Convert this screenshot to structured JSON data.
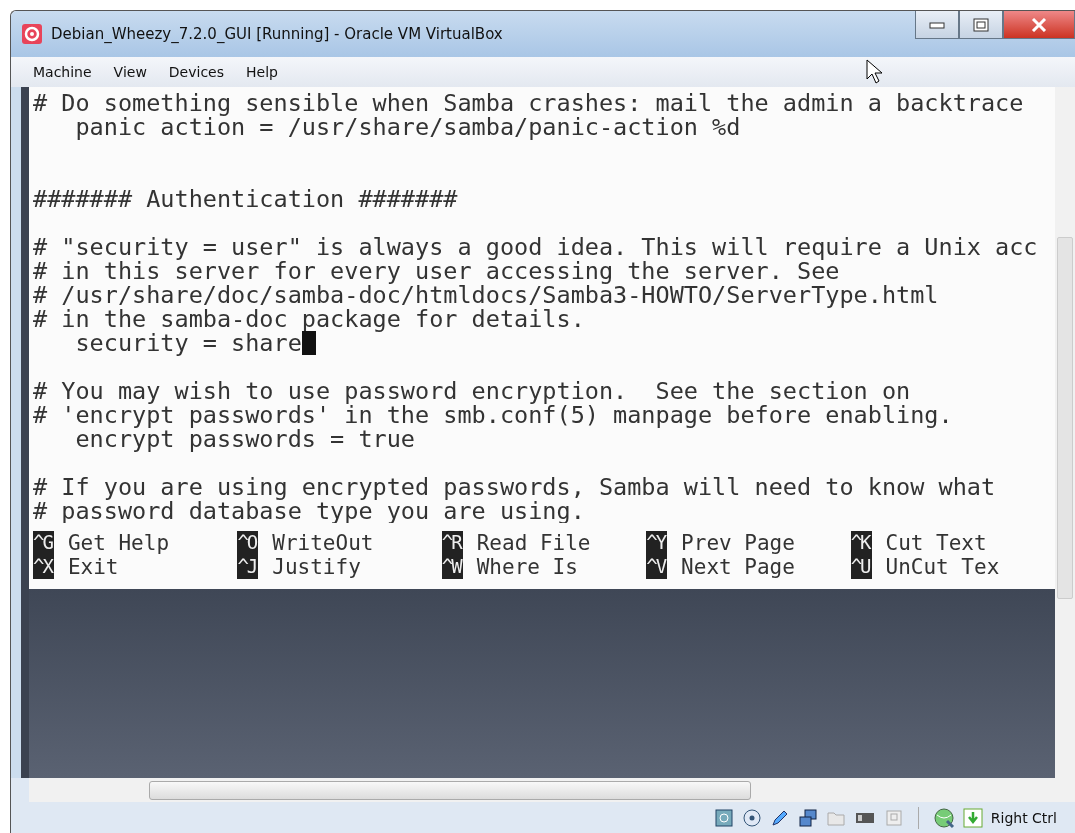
{
  "window": {
    "title": "Debian_Wheezy_7.2.0_GUI [Running] - Oracle VM VirtualBox"
  },
  "menu": [
    "Machine",
    "View",
    "Devices",
    "Help"
  ],
  "editor_lines": [
    {
      "text": "# Do something sensible when Samba crashes: mail the admin a backtrace",
      "cursor": false
    },
    {
      "text": "   panic action = /usr/share/samba/panic-action %d",
      "cursor": false
    },
    {
      "cursor": false
    },
    {
      "cursor": false
    },
    {
      "text": "####### Authentication #######",
      "cursor": false
    },
    {
      "cursor": false
    },
    {
      "text": "# \"security = user\" is always a good idea. This will require a Unix acc",
      "cursor": false
    },
    {
      "text": "# in this server for every user accessing the server. See",
      "cursor": false
    },
    {
      "text": "# /usr/share/doc/samba-doc/htmldocs/Samba3-HOWTO/ServerType.html",
      "cursor": false
    },
    {
      "text": "# in the samba-doc package for details.",
      "cursor": false
    },
    {
      "text": "   security = share",
      "cursor": true
    },
    {
      "cursor": false
    },
    {
      "text": "# You may wish to use password encryption.  See the section on",
      "cursor": false
    },
    {
      "text": "# 'encrypt passwords' in the smb.conf(5) manpage before enabling.",
      "cursor": false
    },
    {
      "text": "   encrypt passwords = true",
      "cursor": false
    },
    {
      "cursor": false
    },
    {
      "text": "# If you are using encrypted passwords, Samba will need to know what",
      "cursor": false
    },
    {
      "text": "# password database type you are using.",
      "cursor": false
    }
  ],
  "shortcuts": [
    [
      {
        "key": "^G",
        "label": "Get Help"
      },
      {
        "key": "^O",
        "label": "WriteOut"
      },
      {
        "key": "^R",
        "label": "Read File"
      },
      {
        "key": "^Y",
        "label": "Prev Page"
      },
      {
        "key": "^K",
        "label": "Cut Text"
      }
    ],
    [
      {
        "key": "^X",
        "label": "Exit"
      },
      {
        "key": "^J",
        "label": "Justify"
      },
      {
        "key": "^W",
        "label": "Where Is"
      },
      {
        "key": "^V",
        "label": "Next Page"
      },
      {
        "key": "^U",
        "label": "UnCut Tex"
      }
    ]
  ],
  "status_bar": {
    "host_key": "Right Ctrl"
  }
}
